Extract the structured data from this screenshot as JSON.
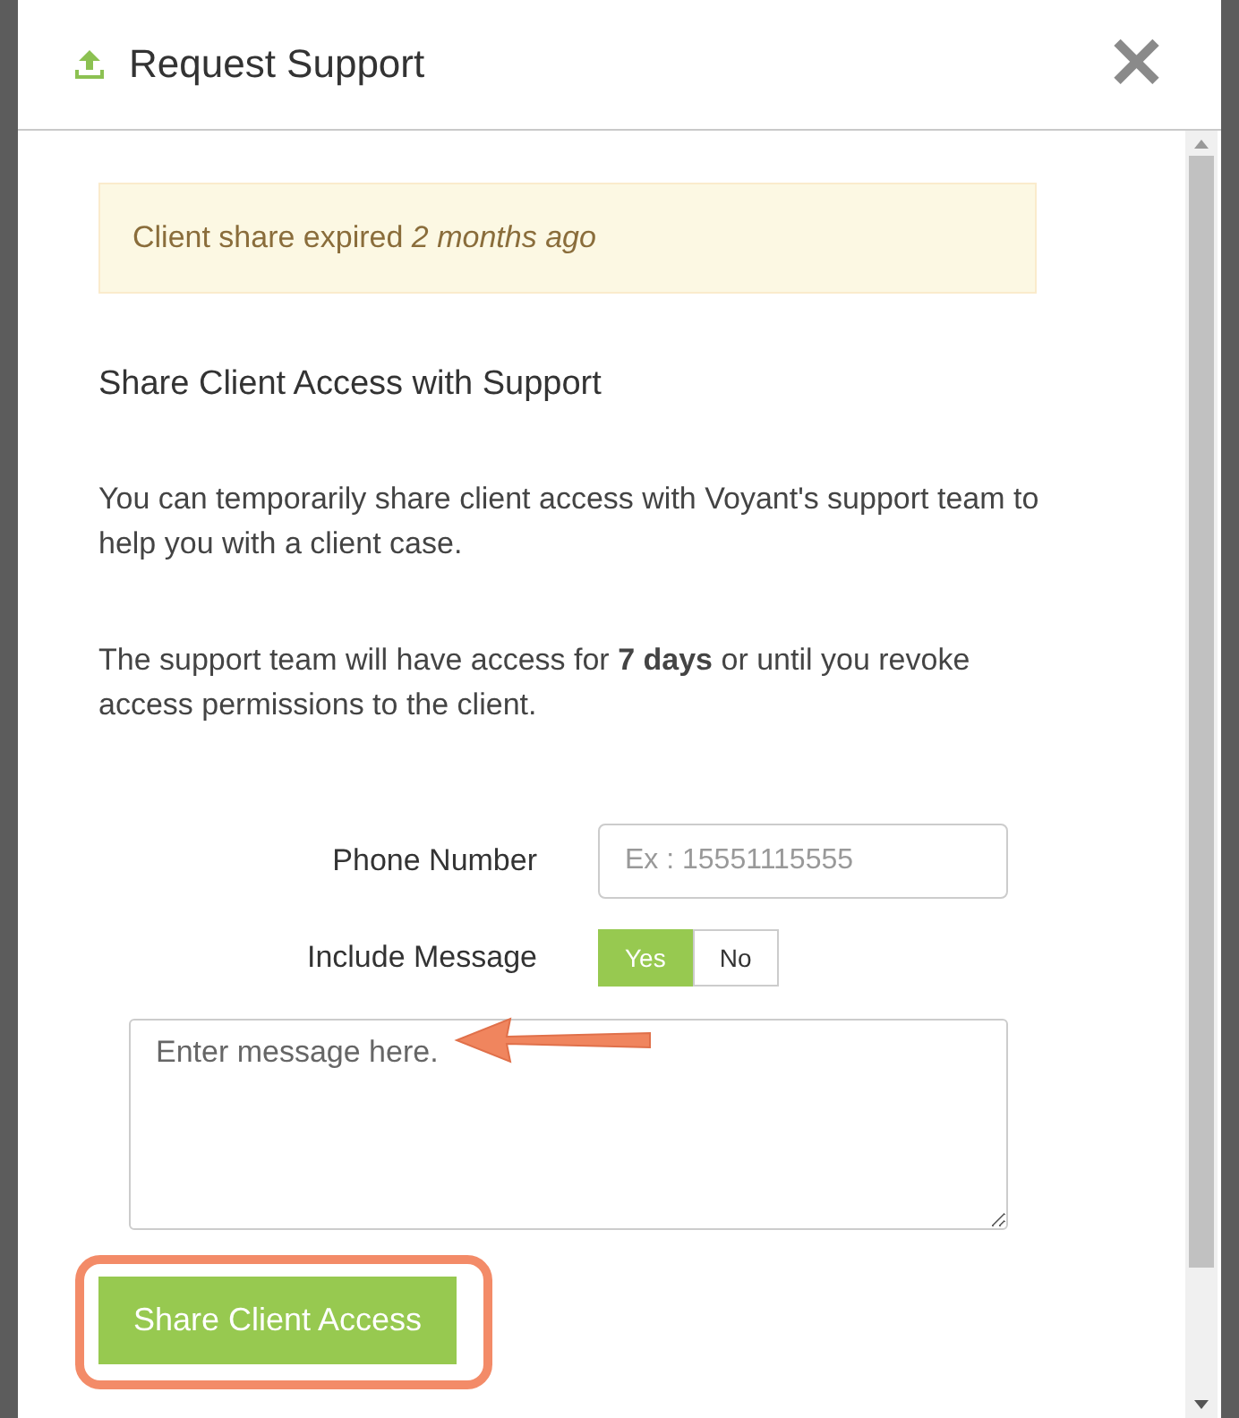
{
  "dialog": {
    "title": "Request Support",
    "close_label": "✕"
  },
  "notice": {
    "text": "Client share expired *2 months ago*"
  },
  "section_title": "Share Client Access with Support",
  "paragraphs": [
    "You can temporarily share client access with Voyant's support team to help you with a client case.",
    "The support team will have access for **7 days** or until you revoke access permissions to the client."
  ],
  "phone": {
    "label": "Phone Number",
    "placeholder": "Ex : 15551115555"
  },
  "include_message": {
    "label": "Include Message",
    "options": [
      {
        "label": "Yes",
        "selected": true
      },
      {
        "label": "No",
        "selected": false
      }
    ]
  },
  "message": {
    "placeholder": "Enter message here."
  },
  "submit_button": "Share Client Access"
}
